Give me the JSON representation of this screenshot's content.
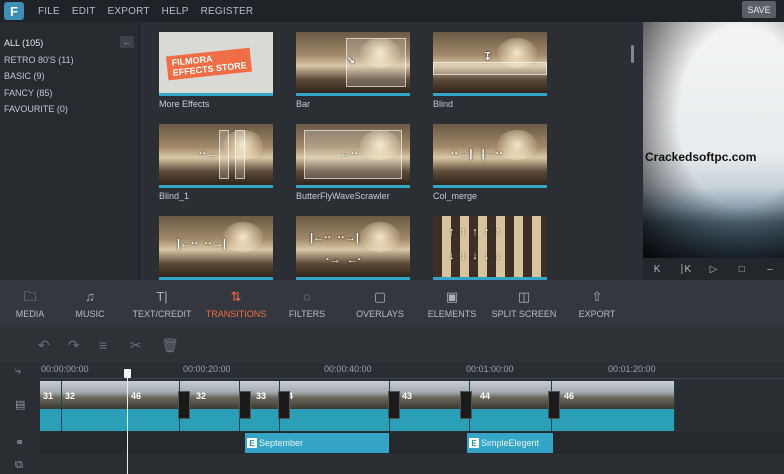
{
  "app": {
    "logo": "F"
  },
  "menu": {
    "items": [
      "FILE",
      "EDIT",
      "EXPORT",
      "HELP",
      "REGISTER"
    ],
    "save_label": "SAVE"
  },
  "categories": [
    {
      "label": "ALL (105)"
    },
    {
      "label": "RETRO 80'S (11)"
    },
    {
      "label": "BASIC (9)"
    },
    {
      "label": "FANCY (85)"
    },
    {
      "label": "FAVOURITE (0)"
    }
  ],
  "effects": [
    {
      "label": "More Effects",
      "store_line1": "FILMORA",
      "store_line2": "EFFECTS STORE"
    },
    {
      "label": "Bar"
    },
    {
      "label": "Blind"
    },
    {
      "label": "Blind_1"
    },
    {
      "label": "ButterFlyWaveScrawler"
    },
    {
      "label": "Col_merge"
    },
    {
      "label": ""
    },
    {
      "label": ""
    },
    {
      "label": ""
    }
  ],
  "preview": {
    "watermark": "Crackedsoftpc.com"
  },
  "tabs": [
    {
      "label": "MEDIA",
      "icon": "folder-icon"
    },
    {
      "label": "MUSIC",
      "icon": "music-note-icon"
    },
    {
      "label": "TEXT/CREDIT",
      "icon": "text-icon"
    },
    {
      "label": "TRANSITIONS",
      "icon": "transitions-icon",
      "active": true
    },
    {
      "label": "FILTERS",
      "icon": "filters-icon"
    },
    {
      "label": "OVERLAYS",
      "icon": "overlays-icon"
    },
    {
      "label": "ELEMENTS",
      "icon": "elements-icon"
    },
    {
      "label": "SPLIT SCREEN",
      "icon": "split-screen-icon"
    },
    {
      "label": "EXPORT",
      "icon": "export-icon"
    }
  ],
  "timeline": {
    "timecodes": [
      "00:00:00:00",
      "00:00:20:00",
      "00:00:40:00",
      "00:01:00:00",
      "00:01:20:00"
    ],
    "clip_numbers": [
      "31",
      "32",
      "46",
      "32",
      "33",
      "34",
      "43",
      "44",
      "46"
    ],
    "effects": [
      "September",
      "SimpleElegent"
    ]
  },
  "colors": {
    "accent": "#34a5c6",
    "active_tab": "#ef6d48",
    "store_tag": "#f06e45"
  }
}
